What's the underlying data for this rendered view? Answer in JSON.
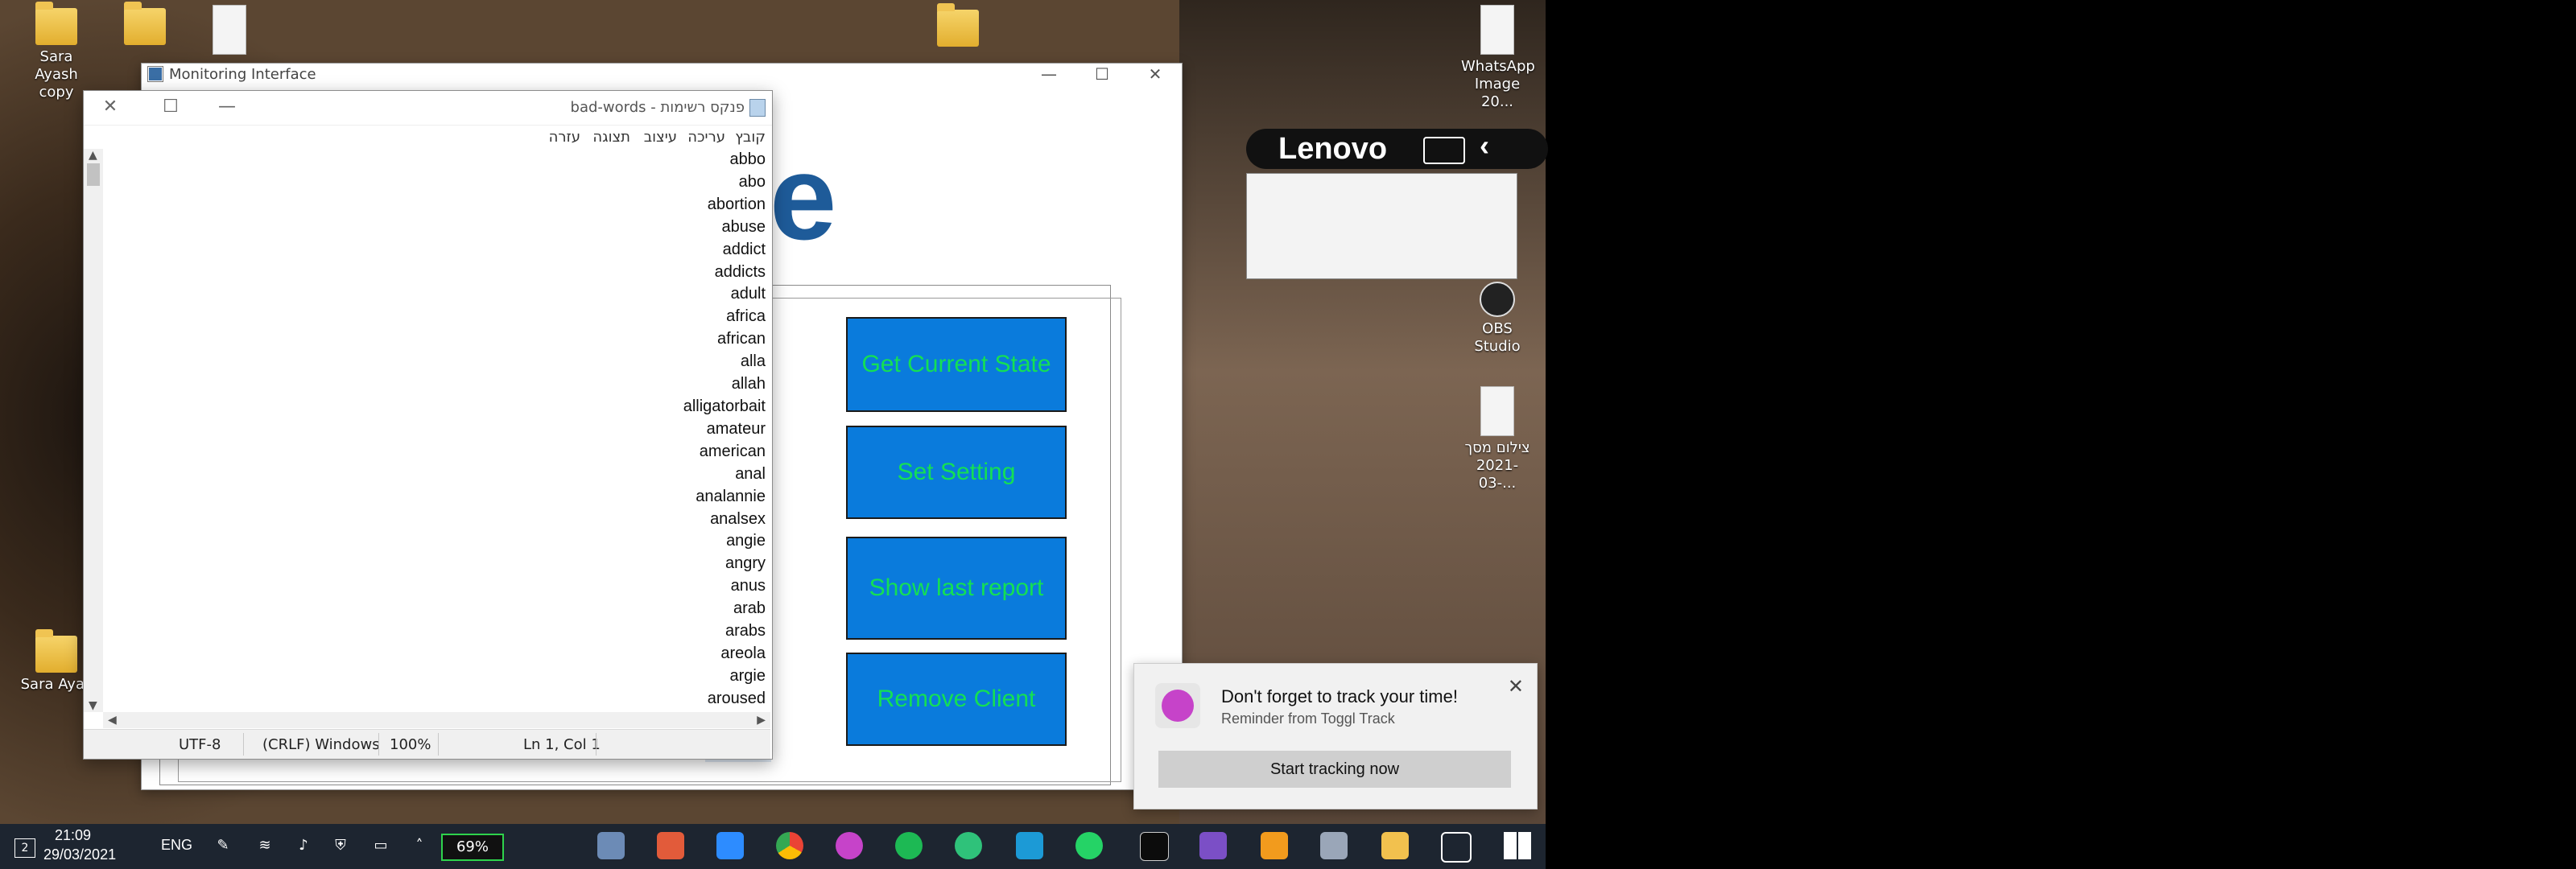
{
  "desktop": {
    "icons": [
      {
        "label": "Sara Ayash copy"
      },
      {
        "label": "Sara Ayas"
      },
      {
        "label": "WhatsApp Image 20..."
      },
      {
        "label": "OBS Studio"
      },
      {
        "label": "צילום מסך 2021-03-..."
      }
    ],
    "lenovo_brand": "Lenovo"
  },
  "monitoring_window": {
    "title": "Monitoring Interface",
    "logo_text": "fe",
    "buttons": [
      {
        "label": "Get Current State"
      },
      {
        "label": "Set Setting"
      },
      {
        "label": "Show last report"
      },
      {
        "label": "Remove Client"
      }
    ]
  },
  "notepad": {
    "title": "bad-words - פנקס רשימות",
    "menu": [
      "קובץ",
      "עריכה",
      "עיצוב",
      "תצוגה",
      "עזרה"
    ],
    "words": [
      "abbo",
      "abo",
      "abortion",
      "abuse",
      "addict",
      "addicts",
      "adult",
      "africa",
      "african",
      "alla",
      "allah",
      "alligatorbait",
      "amateur",
      "american",
      "anal",
      "analannie",
      "analsex",
      "angie",
      "angry",
      "anus",
      "arab",
      "arabs",
      "areola",
      "argie",
      "aroused"
    ],
    "status": {
      "position": "Ln 1, Col 1",
      "zoom": "100%",
      "line_ending": "(CRLF) Windows",
      "encoding": "UTF-8"
    }
  },
  "toast": {
    "title": "Don't forget to track your time!",
    "subtitle": "Reminder from Toggl Track",
    "button": "Start tracking now"
  },
  "taskbar": {
    "time": "21:09",
    "date": "29/03/2021",
    "language": "ENG",
    "battery": "69%",
    "notification_count": "2",
    "accent_color": "#2ed34c"
  },
  "colors": {
    "action_button_bg": "#0a7bdc",
    "action_button_text": "#14e054",
    "logo": "#1e5b99"
  }
}
